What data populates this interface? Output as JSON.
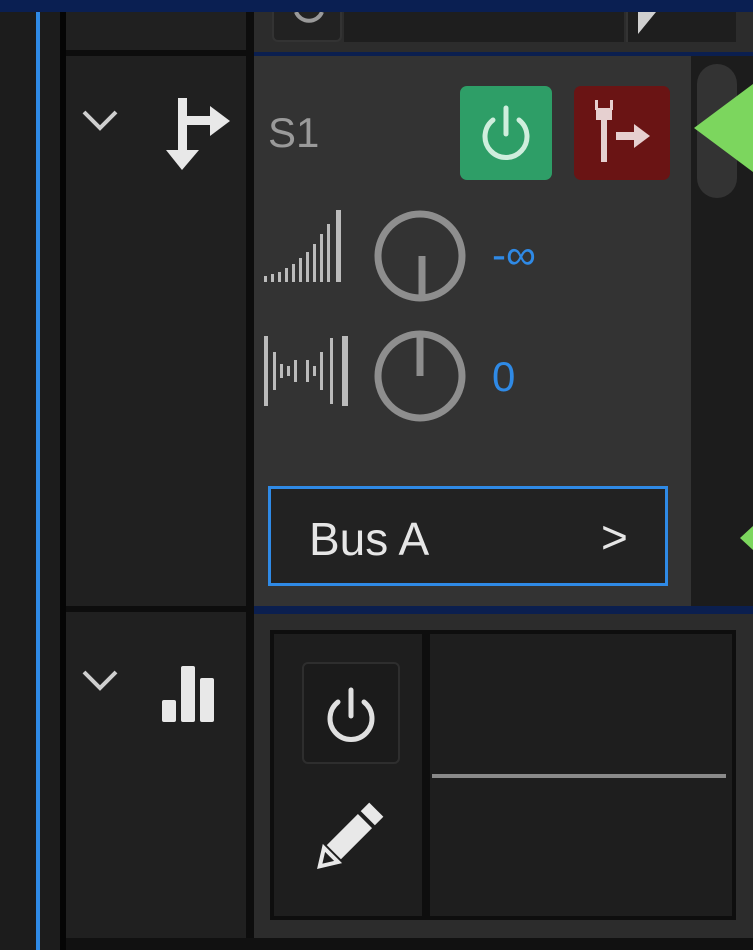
{
  "send": {
    "name": "S1",
    "level_value": "-∞",
    "pan_value": "0",
    "output_label": "Bus A",
    "output_chevron": ">"
  },
  "colors": {
    "accent": "#2f8ae6",
    "power_on": "#2e9e67",
    "pre_fader": "#6a1414",
    "callout": "#7cd65e"
  },
  "icons": {
    "collapse_1": "chevron-down-icon",
    "send_track": "send-track-icon",
    "power": "power-icon",
    "pre_fader": "pre-fader-icon",
    "volume": "volume-icon",
    "pan": "pan-icon",
    "collapse_2": "chevron-down-icon",
    "eq": "bar-chart-icon",
    "edit": "pencil-icon"
  }
}
